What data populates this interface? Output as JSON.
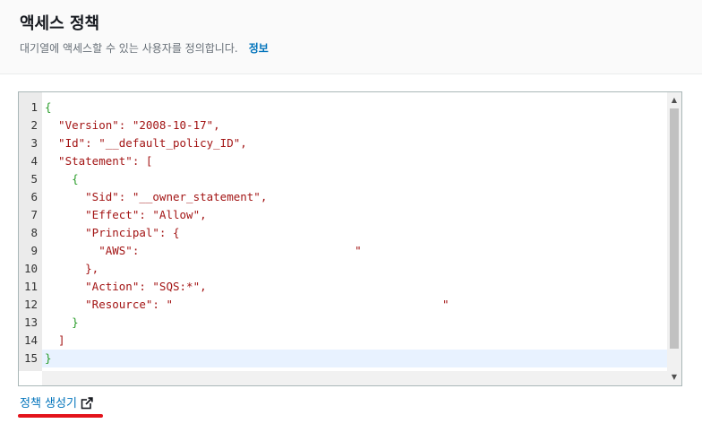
{
  "header": {
    "title": "액세스 정책",
    "subtitle": "대기열에 액세스할 수 있는 사용자를 정의합니다.",
    "info_link": "정보"
  },
  "editor": {
    "lines": [
      {
        "num": "1",
        "text": "{"
      },
      {
        "num": "2",
        "text": "  \"Version\": \"2008-10-17\","
      },
      {
        "num": "3",
        "text": "  \"Id\": \"__default_policy_ID\","
      },
      {
        "num": "4",
        "text": "  \"Statement\": ["
      },
      {
        "num": "5",
        "text": "    {"
      },
      {
        "num": "6",
        "text": "      \"Sid\": \"__owner_statement\","
      },
      {
        "num": "7",
        "text": "      \"Effect\": \"Allow\","
      },
      {
        "num": "8",
        "text": "      \"Principal\": {"
      },
      {
        "num": "9",
        "text": "        \"AWS\":                                \""
      },
      {
        "num": "10",
        "text": "      },"
      },
      {
        "num": "11",
        "text": "      \"Action\": \"SQS:*\","
      },
      {
        "num": "12",
        "text": "      \"Resource\": \"                                        \""
      },
      {
        "num": "13",
        "text": "    }"
      },
      {
        "num": "14",
        "text": "  ]"
      },
      {
        "num": "15",
        "text": "}"
      }
    ],
    "active_line": 15
  },
  "footer": {
    "policy_generator_link": "정책 생성기",
    "link_icon": "external-link-icon",
    "highlight_color": "#e3131b"
  },
  "colors": {
    "string": "#a31515",
    "brace": "#2a9d2a",
    "link": "#0073bb"
  }
}
